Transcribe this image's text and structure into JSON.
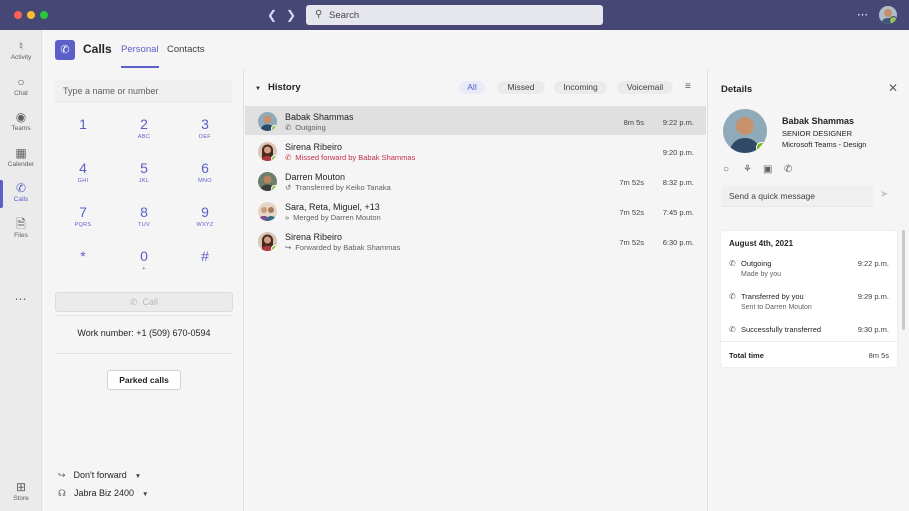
{
  "search": {
    "placeholder": "Search"
  },
  "rail": [
    {
      "label": "Activity",
      "icon": "bell-icon"
    },
    {
      "label": "Chat",
      "icon": "chat-icon"
    },
    {
      "label": "Teams",
      "icon": "teams-icon"
    },
    {
      "label": "Calender",
      "icon": "calendar-icon"
    },
    {
      "label": "Calls",
      "icon": "phone-icon"
    },
    {
      "label": "Files",
      "icon": "file-icon"
    },
    {
      "label": "Store",
      "icon": "store-icon"
    }
  ],
  "header": {
    "title": "Calls",
    "tabs": [
      {
        "label": "Personal"
      },
      {
        "label": "Contacts"
      }
    ]
  },
  "dialpad": {
    "input_placeholder": "Type a name or number",
    "keys": [
      {
        "digit": "1",
        "letters": ""
      },
      {
        "digit": "2",
        "letters": "ABC"
      },
      {
        "digit": "3",
        "letters": "DEF"
      },
      {
        "digit": "4",
        "letters": "GHI"
      },
      {
        "digit": "5",
        "letters": "JKL"
      },
      {
        "digit": "6",
        "letters": "MNO"
      },
      {
        "digit": "7",
        "letters": "PQRS"
      },
      {
        "digit": "8",
        "letters": "TUV"
      },
      {
        "digit": "9",
        "letters": "WXYZ"
      },
      {
        "digit": "*",
        "letters": ""
      },
      {
        "digit": "0",
        "letters": "+"
      },
      {
        "digit": "#",
        "letters": ""
      }
    ],
    "call_label": "Call",
    "work_number": "Work number: +1 (509) 670-0594",
    "parked_label": "Parked calls",
    "forward_label": "Don't forward",
    "device_label": "Jabra Biz 2400"
  },
  "history": {
    "title": "History",
    "filters": [
      {
        "label": "All"
      },
      {
        "label": "Missed"
      },
      {
        "label": "Incoming"
      },
      {
        "label": "Voicemail"
      }
    ],
    "rows": [
      {
        "name": "Babak Shammas",
        "sub": "Outgoing",
        "duration": "8m 5s",
        "time": "9:22 p.m."
      },
      {
        "name": "Sirena Ribeiro",
        "sub": "Missed forward by Babak Shammas",
        "duration": "",
        "time": "9:20 p.m."
      },
      {
        "name": "Darren Mouton",
        "sub": "Transferred by Keiko Tanaka",
        "duration": "7m 52s",
        "time": "8:32 p.m."
      },
      {
        "name": "Sara, Reta, Miguel, +13",
        "sub": "Merged by Darren Mouton",
        "duration": "7m 52s",
        "time": "7:45 p.m."
      },
      {
        "name": "Sirena Ribeiro",
        "sub": "Forwarded by Babak Shammas",
        "duration": "7m 52s",
        "time": "6:30 p.m."
      }
    ]
  },
  "details": {
    "title": "Details",
    "name": "Babak Shammas",
    "role": "SENIOR DESIGNER",
    "org": "Microsoft Teams - Design",
    "quick_placeholder": "Send a quick message",
    "date": "August 4th, 2021",
    "events": [
      {
        "title": "Outgoing",
        "sub": "Made by you",
        "time": "9:22 p.m."
      },
      {
        "title": "Transferred by you",
        "sub": "Sent to Darren Mouton",
        "time": "9:29 p.m."
      },
      {
        "title": "Successfully transferred",
        "sub": "",
        "time": "9:30 p.m."
      }
    ],
    "total_label": "Total time",
    "total_value": "8m 5s"
  }
}
